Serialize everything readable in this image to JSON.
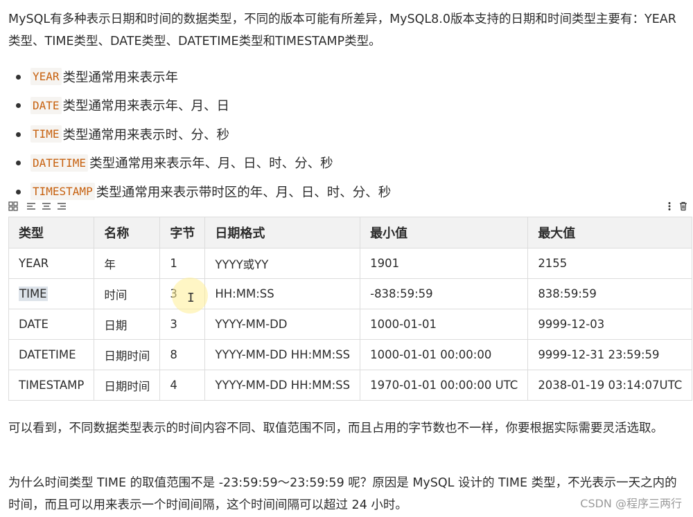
{
  "intro": "MySQL有多种表示日期和时间的数据类型，不同的版本可能有所差异，MySQL8.0版本支持的日期和时间类型主要有：YEAR类型、TIME类型、DATE类型、DATETIME类型和TIMESTAMP类型。",
  "bullets": [
    {
      "code": "YEAR",
      "text": "类型通常用来表示年"
    },
    {
      "code": "DATE",
      "text": "类型通常用来表示年、月、日"
    },
    {
      "code": "TIME",
      "text": "类型通常用来表示时、分、秒"
    },
    {
      "code": "DATETIME",
      "text": "类型通常用来表示年、月、日、时、分、秒"
    },
    {
      "code": "TIMESTAMP",
      "text": "类型通常用来表示带时区的年、月、日、时、分、秒"
    }
  ],
  "toolbar": {
    "grid_icon": "grid-icon",
    "align_left_icon": "align-left-icon",
    "align_center_icon": "align-center-icon",
    "align_right_icon": "align-right-icon",
    "more_icon": "more-vertical-icon",
    "delete_icon": "trash-icon"
  },
  "table": {
    "headers": [
      "类型",
      "名称",
      "字节",
      "日期格式",
      "最小值",
      "最大值"
    ],
    "rows": [
      [
        "YEAR",
        "年",
        "1",
        "YYYY或YY",
        "1901",
        "2155"
      ],
      [
        "TIME",
        "时间",
        "3",
        "HH:MM:SS",
        "-838:59:59",
        "838:59:59"
      ],
      [
        "DATE",
        "日期",
        "3",
        "YYYY-MM-DD",
        "1000-01-01",
        "9999-12-03"
      ],
      [
        "DATETIME",
        "日期时间",
        "8",
        "YYYY-MM-DD HH:MM:SS",
        "1000-01-01 00:00:00",
        "9999-12-31 23:59:59"
      ],
      [
        "TIMESTAMP",
        "日期时间",
        "4",
        "YYYY-MM-DD HH:MM:SS",
        "1970-01-01 00:00:00 UTC",
        "2038-01-19 03:14:07UTC"
      ]
    ]
  },
  "para2": "可以看到，不同数据类型表示的时间内容不同、取值范围不同，而且占用的字节数也不一样，你要根据实际需要灵活选取。",
  "para3": "为什么时间类型 TIME 的取值范围不是 -23:59:59～23:59:59 呢？原因是 MySQL 设计的 TIME 类型，不光表示一天之内的时间，而且可以用来表示一个时间间隔，这个时间间隔可以超过 24 小时。",
  "watermark": "CSDN @程序三两行",
  "colors": {
    "code_text": "#c7610f",
    "code_bg": "#f6f4f1",
    "header_bg": "#f2f2f2",
    "border": "#dcdcdc",
    "selection": "#dde3ea"
  }
}
